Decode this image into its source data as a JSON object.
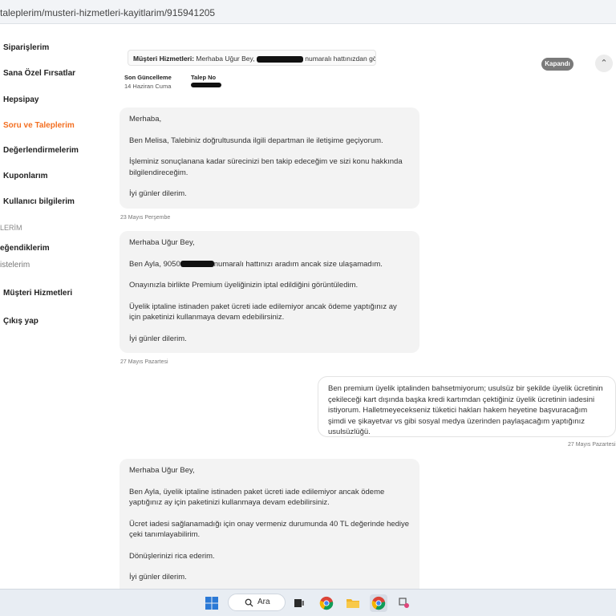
{
  "browser": {
    "url": "taleplerim/musteri-hizmetleri-kayitlarim/915941205"
  },
  "sidebar": {
    "items": [
      {
        "label": "Siparişlerim"
      },
      {
        "label": "Sana Özel Fırsatlar"
      },
      {
        "label": "Hepsipay"
      },
      {
        "label": "Soru ve Taleplerim"
      },
      {
        "label": "Değerlendirmelerim"
      },
      {
        "label": "Kuponlarım"
      },
      {
        "label": "Kullanıcı bilgilerim"
      }
    ],
    "section_label": "LERİM",
    "sub_items": [
      {
        "label": "eğendiklerim"
      },
      {
        "label": "istelerim"
      }
    ],
    "bottom_items": [
      {
        "label": "Müşteri Hizmetleri"
      },
      {
        "label": "Çıkış yap"
      }
    ]
  },
  "ticket": {
    "title_label": "Müşteri Hizmetleri:",
    "title_text_before": "Merhaba Uğur Bey,",
    "title_text_after": "numaralı hattınızdan görü...",
    "status": "Kapandı",
    "last_update_label": "Son Güncelleme",
    "last_update_value": "14 Haziran Cuma",
    "request_no_label": "Talep No"
  },
  "messages": [
    {
      "paragraphs": [
        "Merhaba,",
        "Ben Melisa, Talebiniz doğrultusunda ilgili departman ile iletişime geçiyorum.",
        "İşleminiz sonuçlanana kadar sürecinizi ben takip edeceğim ve sizi konu hakkında bilgilendireceğim.",
        "İyi günler dilerim."
      ],
      "date": "23 Mayıs Perşembe"
    },
    {
      "greeting": "Merhaba Uğur Bey,",
      "line_before": "Ben Ayla, 9050",
      "line_after": "numaralı hattınızı aradım ancak size ulaşamadım.",
      "paragraphs": [
        "Onayınızla birlikte Premium üyeliğinizin iptal edildiğini görüntüledim.",
        "Üyelik iptaline istinaden paket ücreti iade edilemiyor ancak ödeme yaptığınız ay için paketinizi kullanmaya devam edebilirsiniz.",
        "İyi günler dilerim."
      ],
      "date": "27 Mayıs Pazartesi"
    },
    {
      "text": "Ben premium üyelik iptalinden bahsetmiyorum; usulsüz bir şekilde üyelik ücretinin çekileceği kart dışında başka kredi kartımdan çektiğiniz üyelik ücretinin iadesini istiyorum. Halletmeyecekseniz tüketici hakları hakem heyetine başvuracağım şimdi ve şikayetvar vs gibi sosyal medya üzerinden paylaşacağım yaptığınız usulsüzlüğü.",
      "date": "27 Mayıs Pazartesi"
    },
    {
      "paragraphs": [
        "Merhaba Uğur Bey,",
        "Ben Ayla, üyelik iptaline istinaden paket ücreti iade edilemiyor ancak ödeme yaptığınız ay için paketinizi kullanmaya devam edebilirsiniz.",
        "Ücret iadesi sağlanamadığı için onay vermeniz durumunda 40 TL değerinde hediye çeki tanımlayabilirim.",
        "Dönüşlerinizi rica ederim.",
        "İyi günler dilerim."
      ]
    }
  ],
  "taskbar": {
    "search_label": "Ara"
  },
  "colors": {
    "accent": "#f36f21",
    "bubble_bg": "#f3f3f3",
    "status_badge": "#7a7a7a"
  }
}
